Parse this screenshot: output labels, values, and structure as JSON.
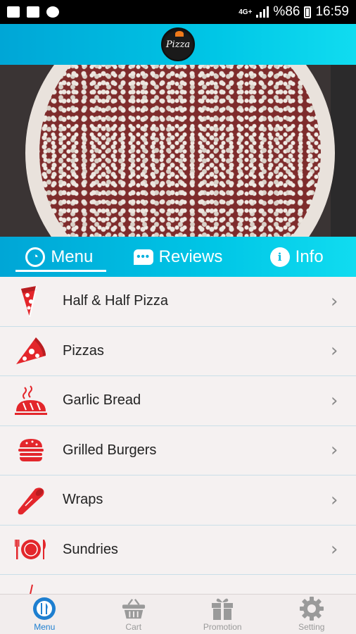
{
  "status_bar": {
    "battery": "%86",
    "time": "16:59",
    "network": "4G+"
  },
  "header": {
    "logo_text": "Pizza"
  },
  "tabs": [
    {
      "label": "Menu",
      "icon": "pizza-icon",
      "active": true
    },
    {
      "label": "Reviews",
      "icon": "chat-icon",
      "active": false
    },
    {
      "label": "Info",
      "icon": "info-icon",
      "active": false
    }
  ],
  "menu_items": [
    {
      "label": "Half & Half Pizza",
      "icon": "half-pizza-icon"
    },
    {
      "label": "Pizzas",
      "icon": "pizza-slice-icon"
    },
    {
      "label": "Garlic Bread",
      "icon": "garlic-bread-icon"
    },
    {
      "label": "Grilled Burgers",
      "icon": "burger-icon"
    },
    {
      "label": "Wraps",
      "icon": "wrap-icon"
    },
    {
      "label": "Sundries",
      "icon": "plate-icon"
    },
    {
      "label": "",
      "icon": "drink-icon"
    }
  ],
  "bottom_nav": [
    {
      "label": "Menu",
      "icon": "menu-icon",
      "active": true
    },
    {
      "label": "Cart",
      "icon": "basket-icon",
      "active": false
    },
    {
      "label": "Promotion",
      "icon": "gift-icon",
      "active": false
    },
    {
      "label": "Setting",
      "icon": "gear-icon",
      "active": false
    }
  ],
  "colors": {
    "accent": "#00c6e6",
    "icon_red": "#e3262b",
    "active_nav": "#1e7fd0"
  }
}
